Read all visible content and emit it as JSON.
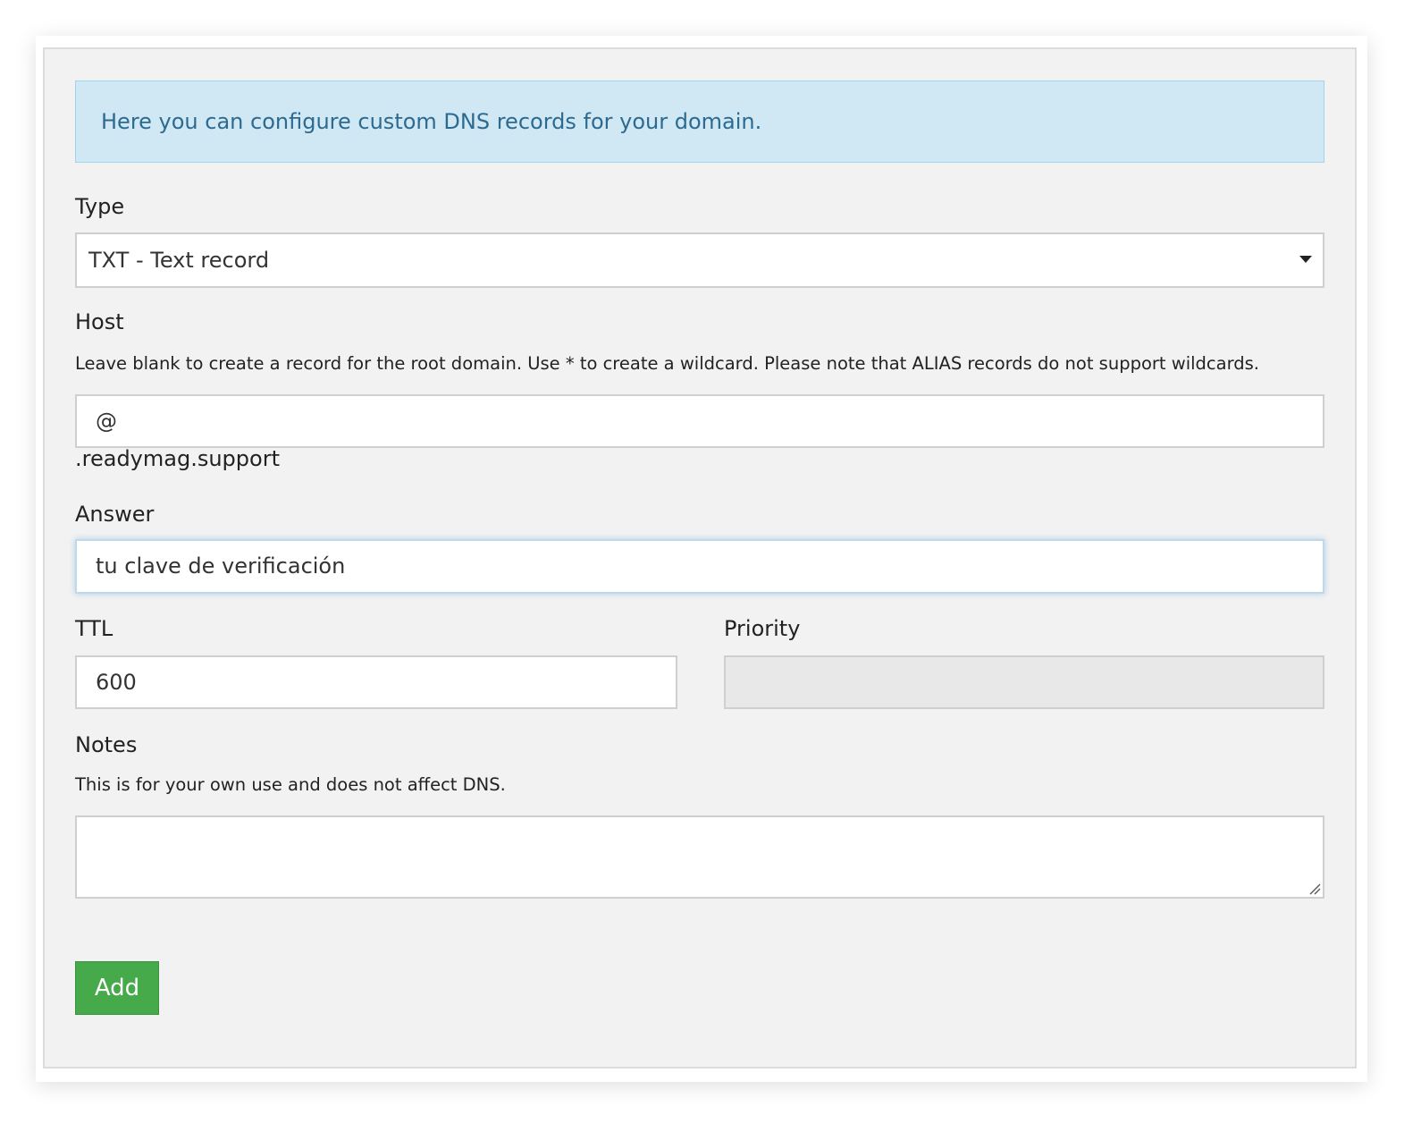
{
  "info": {
    "message": "Here you can configure custom DNS records for your domain."
  },
  "type_field": {
    "label": "Type",
    "selected": "TXT - Text record",
    "icon": "caret-down-icon"
  },
  "host_field": {
    "label": "Host",
    "help": "Leave blank to create a record for the root domain. Use * to create a wildcard. Please note that ALIAS records do not support wildcards.",
    "value": "@",
    "suffix": ".readymag.support"
  },
  "answer_field": {
    "label": "Answer",
    "value": "tu clave de verificación"
  },
  "ttl_field": {
    "label": "TTL",
    "value": "600"
  },
  "priority_field": {
    "label": "Priority",
    "value": ""
  },
  "notes_field": {
    "label": "Notes",
    "help": "This is for your own use and does not affect DNS.",
    "value": ""
  },
  "actions": {
    "add_label": "Add"
  },
  "colors": {
    "info_background": "#d0e7f4",
    "info_text": "#2d6a90",
    "add_button": "#46a94a",
    "panel_background": "#f2f2f2"
  }
}
